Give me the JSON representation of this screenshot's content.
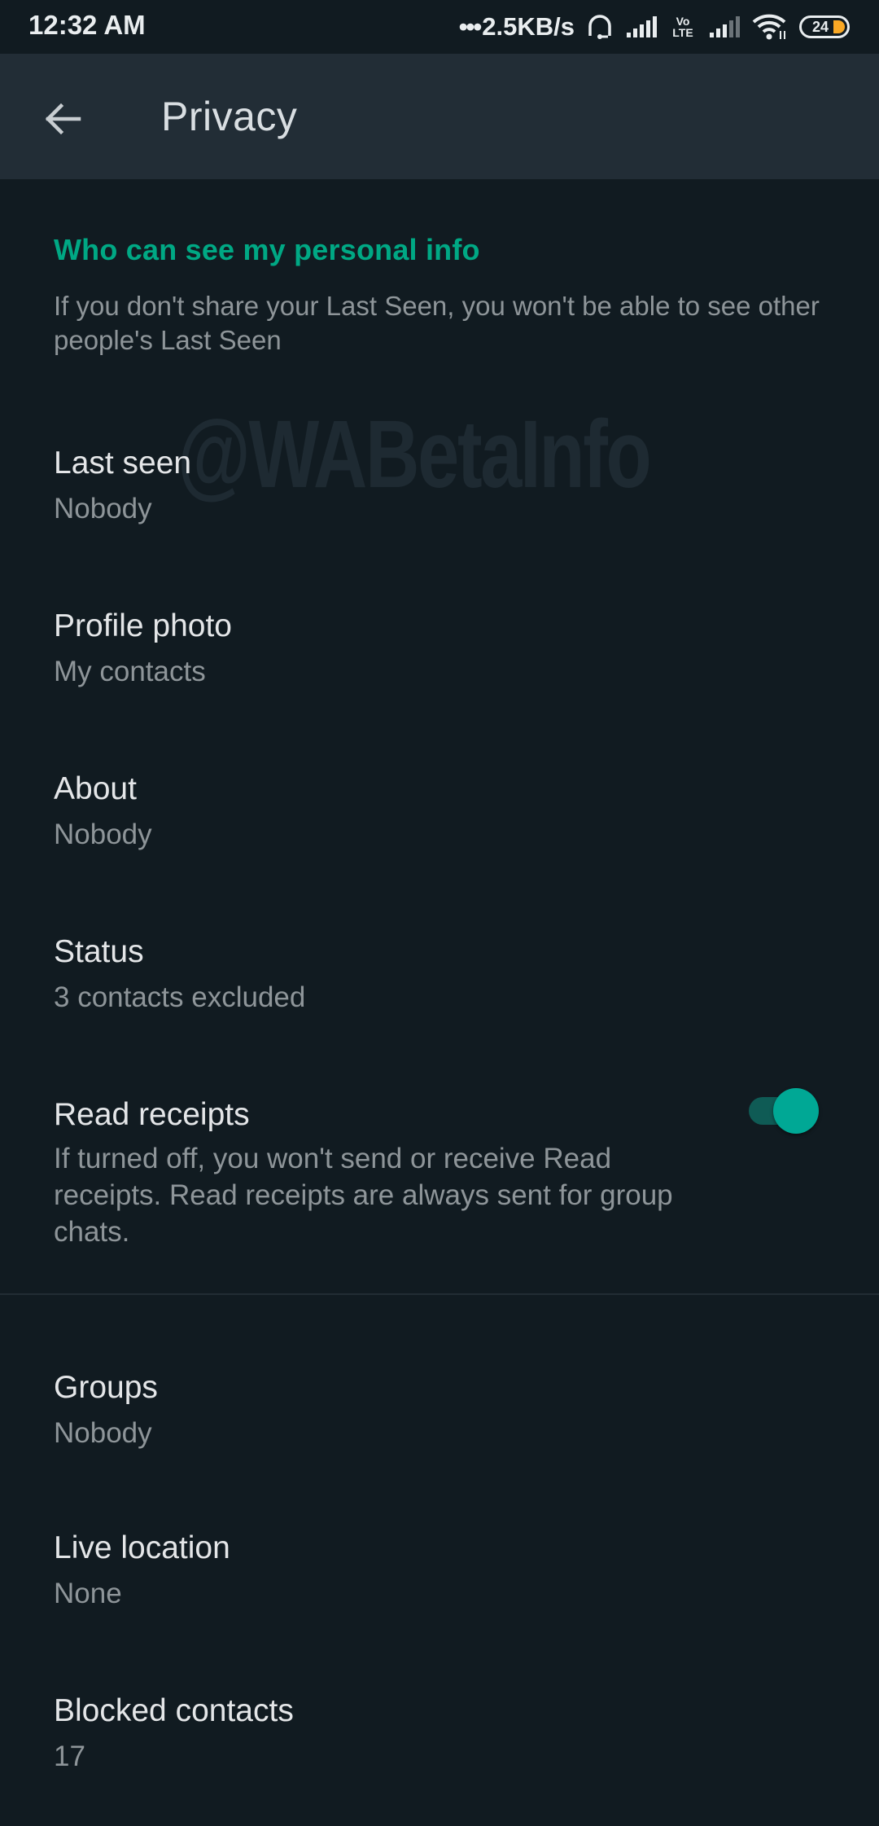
{
  "status_bar": {
    "time": "12:32 AM",
    "net_dots": "•••",
    "net_speed": "2.5KB/s",
    "icons": [
      "headset-icon",
      "signal-icon",
      "volte-icon",
      "signal-icon",
      "wifi-icon",
      "battery-icon"
    ],
    "volte_top": "Vo",
    "volte_bottom": "LTE",
    "battery_level": "24",
    "battery_color": "#f9a825"
  },
  "app_bar": {
    "back_icon": "arrow-left-icon",
    "title": "Privacy"
  },
  "section": {
    "header": "Who can see my personal info",
    "description": "If you don't share your Last Seen, you won't be able to see other people's Last Seen",
    "accent_color": "#00a884"
  },
  "watermark": "@WABetaInfo",
  "settings": [
    {
      "title": "Last seen",
      "value": "Nobody"
    },
    {
      "title": "Profile photo",
      "value": "My contacts"
    },
    {
      "title": "About",
      "value": "Nobody"
    },
    {
      "title": "Status",
      "value": "3 contacts excluded"
    },
    {
      "title": "Read receipts",
      "value": "If turned off, you won't send or receive Read receipts. Read receipts are always sent for group chats.",
      "toggle_on": true
    }
  ],
  "settings_more": [
    {
      "title": "Groups",
      "value": "Nobody"
    },
    {
      "title": "Live location",
      "value": "None"
    },
    {
      "title": "Blocked contacts",
      "value": "17"
    }
  ]
}
